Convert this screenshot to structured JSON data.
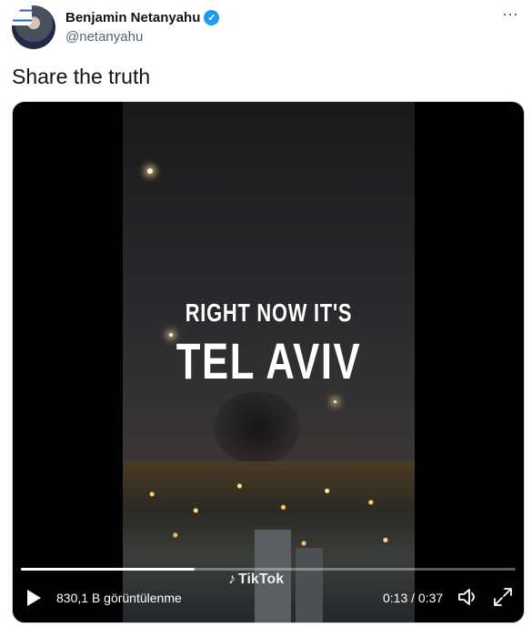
{
  "author": {
    "name": "Benjamin Netanyahu",
    "handle": "@netanyahu",
    "verified_icon": "verified-badge-icon",
    "avatar_icon": "user-avatar"
  },
  "menu": {
    "more_glyph": "⋯"
  },
  "tweet": {
    "text": "Share the truth"
  },
  "video": {
    "overlay_line1": "RIGHT NOW IT'S",
    "overlay_line2": "TEL AVIV",
    "watermark": "TikTok",
    "views": "830,1 B görüntülenme",
    "current_time": "0:13",
    "duration": "0:37",
    "time_display": "0:13 / 0:37",
    "progress_fraction": 0.351,
    "accent_color": "#1d9bf0"
  }
}
